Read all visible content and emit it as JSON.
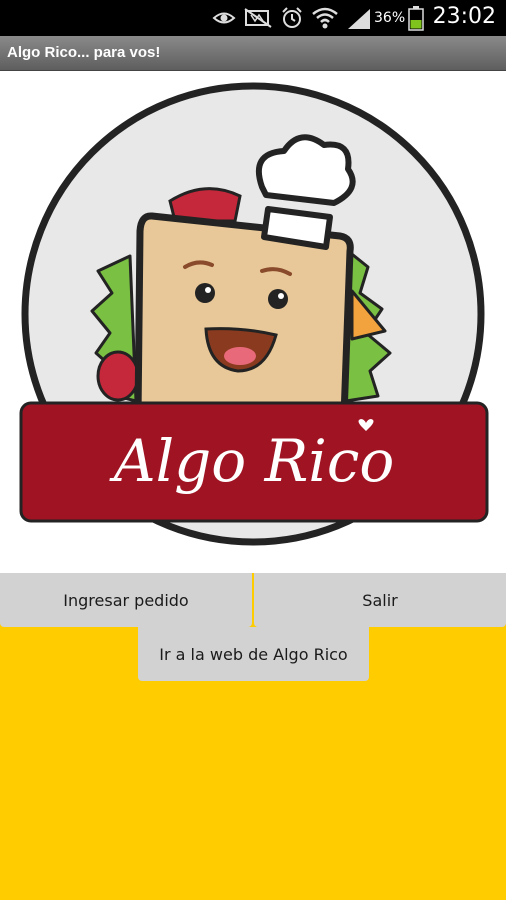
{
  "status_bar": {
    "battery_percent": "36%",
    "time": "23:02",
    "icons": [
      "eye-icon",
      "mute-icon",
      "alarm-icon",
      "wifi-icon",
      "signal-icon",
      "battery-icon"
    ]
  },
  "app_bar": {
    "title": "Algo Rico... para vos!"
  },
  "logo": {
    "brand_text": "Algo Rico"
  },
  "buttons": {
    "order_label": "Ingresar pedido",
    "exit_label": "Salir",
    "web_label": "Ir a la web de Algo Rico"
  },
  "colors": {
    "background_yellow": "#ffcc00",
    "brand_red": "#a01323",
    "button_gray": "#d2d2d2"
  }
}
